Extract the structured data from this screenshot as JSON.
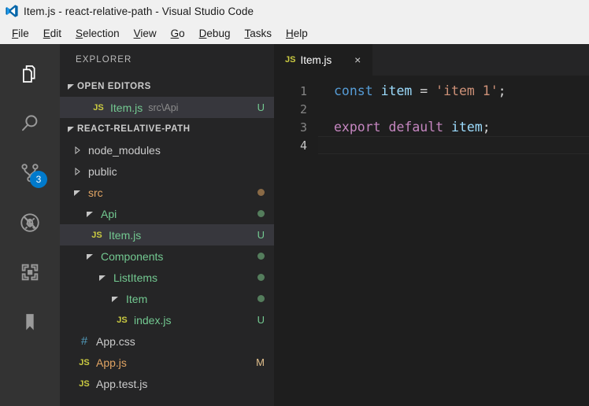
{
  "window": {
    "title": "Item.js - react-relative-path - Visual Studio Code",
    "logo_icon": "vscode-logo-icon"
  },
  "menubar": {
    "items": [
      {
        "label": "File",
        "mnemonic": "F",
        "rest": "ile"
      },
      {
        "label": "Edit",
        "mnemonic": "E",
        "rest": "dit"
      },
      {
        "label": "Selection",
        "mnemonic": "S",
        "rest": "election"
      },
      {
        "label": "View",
        "mnemonic": "V",
        "rest": "iew"
      },
      {
        "label": "Go",
        "mnemonic": "G",
        "rest": "o"
      },
      {
        "label": "Debug",
        "mnemonic": "D",
        "rest": "ebug"
      },
      {
        "label": "Tasks",
        "mnemonic": "T",
        "rest": "asks"
      },
      {
        "label": "Help",
        "mnemonic": "H",
        "rest": "elp"
      }
    ]
  },
  "activitybar": {
    "items": [
      {
        "name": "explorer-icon",
        "title": "Explorer",
        "active": true,
        "badge": ""
      },
      {
        "name": "search-icon",
        "title": "Search",
        "active": false,
        "badge": ""
      },
      {
        "name": "source-control-icon",
        "title": "Source Control",
        "active": false,
        "badge": "3"
      },
      {
        "name": "debug-icon",
        "title": "Debug",
        "active": false,
        "badge": ""
      },
      {
        "name": "extensions-icon",
        "title": "Extensions",
        "active": false,
        "badge": ""
      },
      {
        "name": "bookmarks-icon",
        "title": "Bookmarks",
        "active": false,
        "badge": ""
      }
    ],
    "badge_color": "#007acc"
  },
  "sidebar": {
    "title": "EXPLORER",
    "open_editors": {
      "header": "OPEN EDITORS",
      "expanded": true,
      "items": [
        {
          "icon": "js-file-icon",
          "icon_text": "JS",
          "name": "Item.js",
          "path": "src\\Api",
          "status": "U",
          "selected": true,
          "color": "#73c991"
        }
      ]
    },
    "project": {
      "header": "REACT-RELATIVE-PATH",
      "expanded": true,
      "items": [
        {
          "label": "node_modules",
          "type": "folder",
          "expanded": false,
          "indent": 1,
          "color": "#cccccc",
          "status": "",
          "dot": ""
        },
        {
          "label": "public",
          "type": "folder",
          "expanded": false,
          "indent": 1,
          "color": "#cccccc",
          "status": "",
          "dot": ""
        },
        {
          "label": "src",
          "type": "folder",
          "expanded": true,
          "indent": 1,
          "color": "#e2a564",
          "status": "",
          "dot": "#8a6a46"
        },
        {
          "label": "Api",
          "type": "folder",
          "expanded": true,
          "indent": 2,
          "color": "#73c991",
          "status": "",
          "dot": "#547d5c"
        },
        {
          "label": "Item.js",
          "type": "file",
          "icon_text": "JS",
          "icon": "js-file-icon",
          "indent": 3,
          "color": "#73c991",
          "status": "U",
          "selected": true,
          "dot": ""
        },
        {
          "label": "Components",
          "type": "folder",
          "expanded": true,
          "indent": 2,
          "color": "#73c991",
          "status": "",
          "dot": "#547d5c"
        },
        {
          "label": "ListItems",
          "type": "folder",
          "expanded": true,
          "indent": 3,
          "color": "#73c991",
          "status": "",
          "dot": "#547d5c"
        },
        {
          "label": "Item",
          "type": "folder",
          "expanded": true,
          "indent": 4,
          "color": "#73c991",
          "status": "",
          "dot": "#547d5c"
        },
        {
          "label": "index.js",
          "type": "file",
          "icon_text": "JS",
          "icon": "js-file-icon",
          "indent": 5,
          "color": "#73c991",
          "status": "U",
          "dot": ""
        },
        {
          "label": "App.css",
          "type": "file",
          "icon_text": "#",
          "icon": "css-file-icon",
          "indent": 2,
          "color": "#cccccc",
          "status": "",
          "dot": ""
        },
        {
          "label": "App.js",
          "type": "file",
          "icon_text": "JS",
          "icon": "js-file-icon",
          "indent": 2,
          "color": "#e2a564",
          "status": "M",
          "dot": ""
        },
        {
          "label": "App.test.js",
          "type": "file",
          "icon_text": "JS",
          "icon": "js-file-icon",
          "indent": 2,
          "color": "#cccccc",
          "status": "",
          "dot": ""
        }
      ]
    }
  },
  "editor": {
    "tabs": [
      {
        "icon_text": "JS",
        "label": "Item.js",
        "active": true,
        "close": "×"
      }
    ],
    "lines": [
      {
        "number": "1",
        "active": false,
        "current": false,
        "tokens": [
          {
            "text": "const",
            "type": "keyword"
          },
          {
            "text": " ",
            "type": "plain"
          },
          {
            "text": "item",
            "type": "variable"
          },
          {
            "text": " = ",
            "type": "plain"
          },
          {
            "text": "'item 1'",
            "type": "string"
          },
          {
            "text": ";",
            "type": "plain"
          }
        ]
      },
      {
        "number": "2",
        "active": false,
        "current": false,
        "tokens": []
      },
      {
        "number": "3",
        "active": false,
        "current": false,
        "tokens": [
          {
            "text": "export",
            "type": "control"
          },
          {
            "text": " ",
            "type": "plain"
          },
          {
            "text": "default",
            "type": "control"
          },
          {
            "text": " ",
            "type": "plain"
          },
          {
            "text": "item",
            "type": "variable"
          },
          {
            "text": ";",
            "type": "plain"
          }
        ]
      },
      {
        "number": "4",
        "active": true,
        "current": true,
        "tokens": []
      }
    ]
  },
  "theme": {
    "titlebar_bg": "#f0f0f0",
    "activitybar_bg": "#333333",
    "sidebar_bg": "#252526",
    "editor_bg": "#1e1e1e",
    "selection_bg": "#37373d",
    "accent": "#007acc",
    "git_untracked": "#73c991",
    "git_modified": "#e2c08d"
  }
}
